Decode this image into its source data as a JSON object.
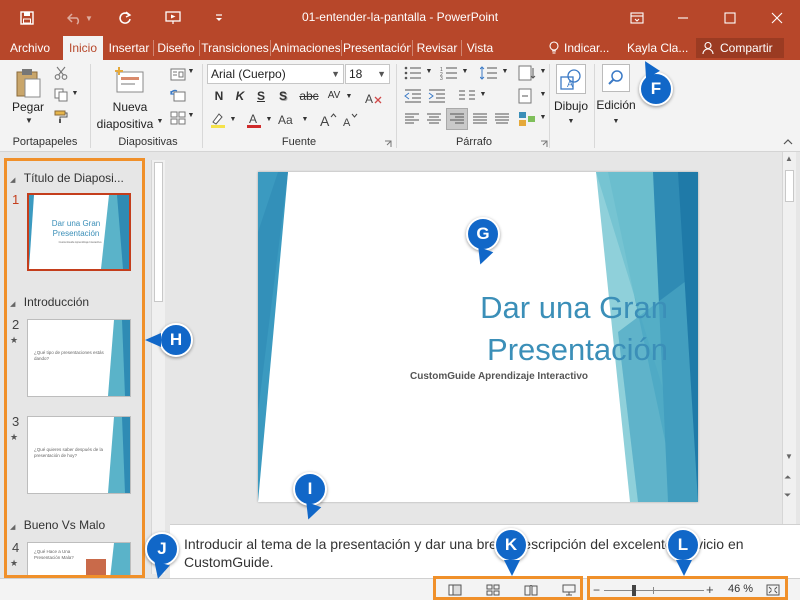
{
  "titlebar": {
    "title": "01-entender-la-pantalla - PowerPoint"
  },
  "tabs": {
    "items": [
      "Archivo",
      "Inicio",
      "Insertar",
      "Diseño",
      "Transiciones",
      "Animaciones",
      "Presentación",
      "Revisar",
      "Vista"
    ],
    "tell_me": "Indicar...",
    "user": "Kayla Cla...",
    "share": "Compartir"
  },
  "ribbon": {
    "paste_label": "Pegar",
    "new_slide_label1": "Nueva",
    "new_slide_label2": "diapositiva",
    "font_name": "Arial (Cuerpo)",
    "font_size": "18",
    "fmt": [
      "N",
      "K",
      "S",
      "S",
      "abc",
      "AV"
    ],
    "draw_label": "Dibujo",
    "edit_label": "Edición",
    "groups": {
      "clipboard": "Portapapeles",
      "slides": "Diapositivas",
      "font": "Fuente",
      "paragraph": "Párrafo"
    }
  },
  "slides_panel": {
    "sections": [
      "Título de Diaposi...",
      "Introducción",
      "Bueno Vs Malo"
    ],
    "slides": [
      {
        "number": "1",
        "title": "Dar una Gran Presentación",
        "subtitle": "CustomGuide Aprendizaje Interactivo"
      },
      {
        "number": "2",
        "title": "¿Qué tipo de presentaciones estás dando?"
      },
      {
        "number": "3",
        "title": "¿Qué quieres saber después de la presentación de hoy?"
      },
      {
        "number": "4",
        "title": "¿Qué Hace a Una Presentación Mala?"
      }
    ]
  },
  "slide": {
    "title_line1": "Dar una Gran",
    "title_line2": "Presentación",
    "subtitle": "CustomGuide Aprendizaje Interactivo"
  },
  "notes": {
    "text": "Introducir al tema de la presentación y dar una breve descripción del excelente servicio en CustomGuide."
  },
  "statusbar": {
    "zoom": "46 %",
    "zoom_fraction": 0.3
  },
  "callouts": {
    "F": "F",
    "G": "G",
    "H": "H",
    "I": "I",
    "J": "J",
    "K": "K",
    "L": "L"
  },
  "colors": {
    "accent": "#b7472a",
    "slide_title": "#3b8fb8",
    "callout": "#1167c8",
    "highlight_box": "#f0902a"
  }
}
